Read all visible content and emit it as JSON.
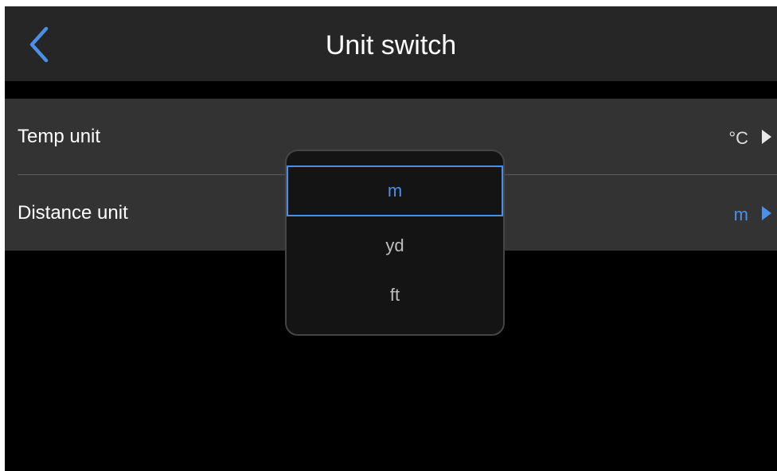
{
  "header": {
    "title": "Unit switch",
    "back_icon": "chevron-left-icon"
  },
  "settings": {
    "rows": [
      {
        "label": "Temp unit",
        "value": "°C",
        "value_color": "#dddddd"
      },
      {
        "label": "Distance unit",
        "value": "m",
        "value_color": "#4a90e8"
      }
    ]
  },
  "picker": {
    "options": [
      "m",
      "yd",
      "ft"
    ],
    "selected": "m"
  },
  "colors": {
    "accent": "#4a90e8",
    "header_bg": "#262626",
    "panel_bg": "#333333",
    "screen_bg": "#000000"
  }
}
